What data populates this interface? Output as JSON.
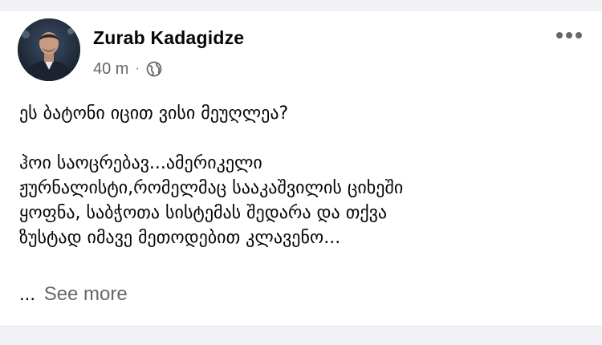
{
  "post": {
    "author": "Zurab Kadagidze",
    "time": "40 m",
    "separator": "·",
    "privacy_icon": "globe-icon",
    "menu_icon": "more-horizontal-icon",
    "lines": [
      "ეს ბატონი იცით ვისი მეუღლეა?",
      "",
      "ჰოი საოცრებავ...ამერიკელი",
      "ჟურნალისტი,რომელმაც სააკაშვილის ციხეში",
      "ყოფნა, საბჭოთა სისტემას შედარა და თქვა",
      "ზუსტად იმავე მეთოდებით კლავენო..."
    ],
    "ellipsis": "...",
    "see_more": "See more"
  },
  "colors": {
    "text": "#050505",
    "secondary": "#65676b",
    "divider": "#f0f2f5"
  }
}
